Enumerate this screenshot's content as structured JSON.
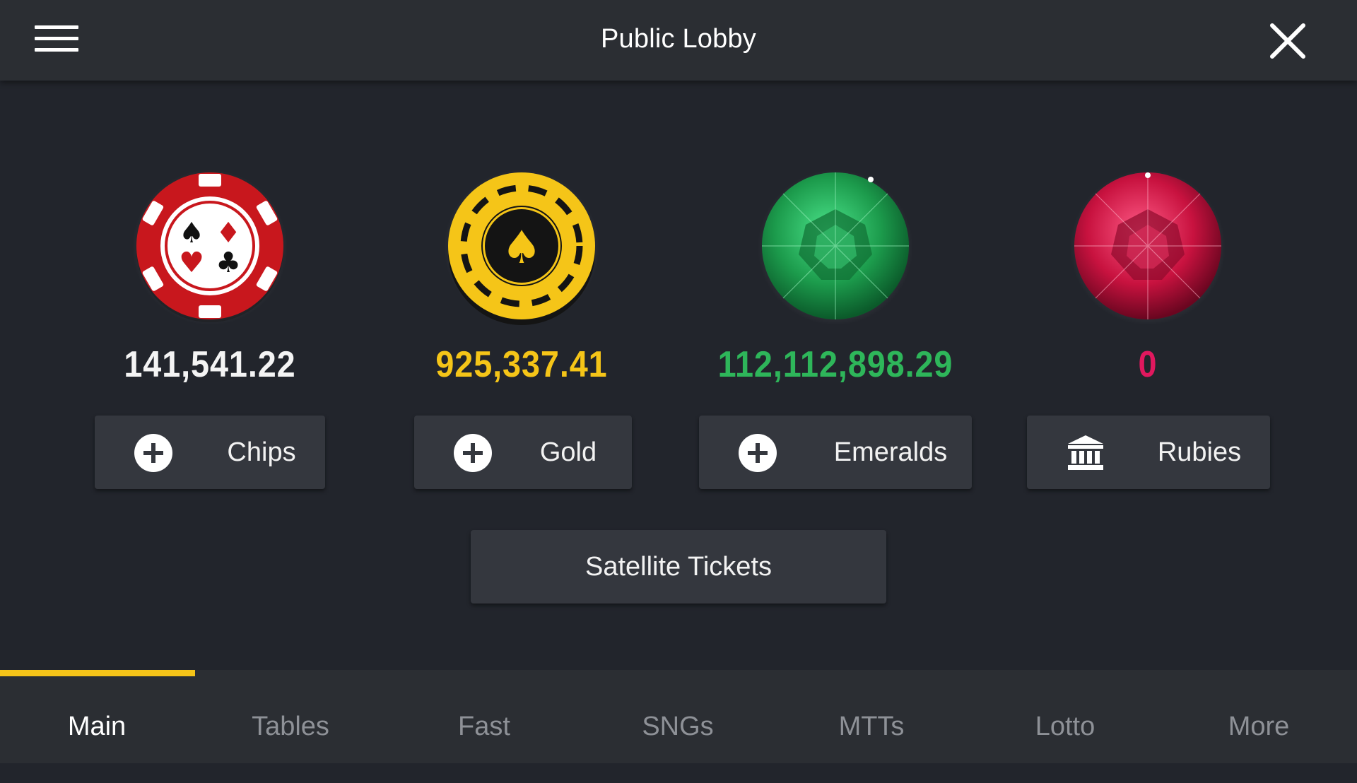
{
  "header": {
    "title": "Public Lobby",
    "menu_icon": "hamburger-menu-icon",
    "close_icon": "close-icon"
  },
  "currencies": [
    {
      "name": "Chips",
      "amount": "141,541.22",
      "color": "#f4f4f4",
      "icon": "poker-chip-icon",
      "button_label": "Chips",
      "button_icon": "plus-circle-icon"
    },
    {
      "name": "Gold",
      "amount": "925,337.41",
      "color": "#f5c518",
      "icon": "gold-coin-icon",
      "button_label": "Gold",
      "button_icon": "plus-circle-icon"
    },
    {
      "name": "Emeralds",
      "amount": "112,112,898.29",
      "color": "#2eb65a",
      "icon": "emerald-gem-icon",
      "button_label": "Emeralds",
      "button_icon": "plus-circle-icon"
    },
    {
      "name": "Rubies",
      "amount": "0",
      "color": "#e0185e",
      "icon": "ruby-gem-icon",
      "button_label": "Rubies",
      "button_icon": "bank-icon"
    }
  ],
  "satellite_button": "Satellite Tickets",
  "tabs": [
    {
      "label": "Main",
      "active": true
    },
    {
      "label": "Tables",
      "active": false
    },
    {
      "label": "Fast",
      "active": false
    },
    {
      "label": "SNGs",
      "active": false
    },
    {
      "label": "MTTs",
      "active": false
    },
    {
      "label": "Lotto",
      "active": false
    },
    {
      "label": "More",
      "active": false
    }
  ],
  "colors": {
    "background": "#22252c",
    "bar": "#2b2e33",
    "button": "#34373e",
    "accent": "#f5c418",
    "inactive_tab": "#8e9197"
  }
}
